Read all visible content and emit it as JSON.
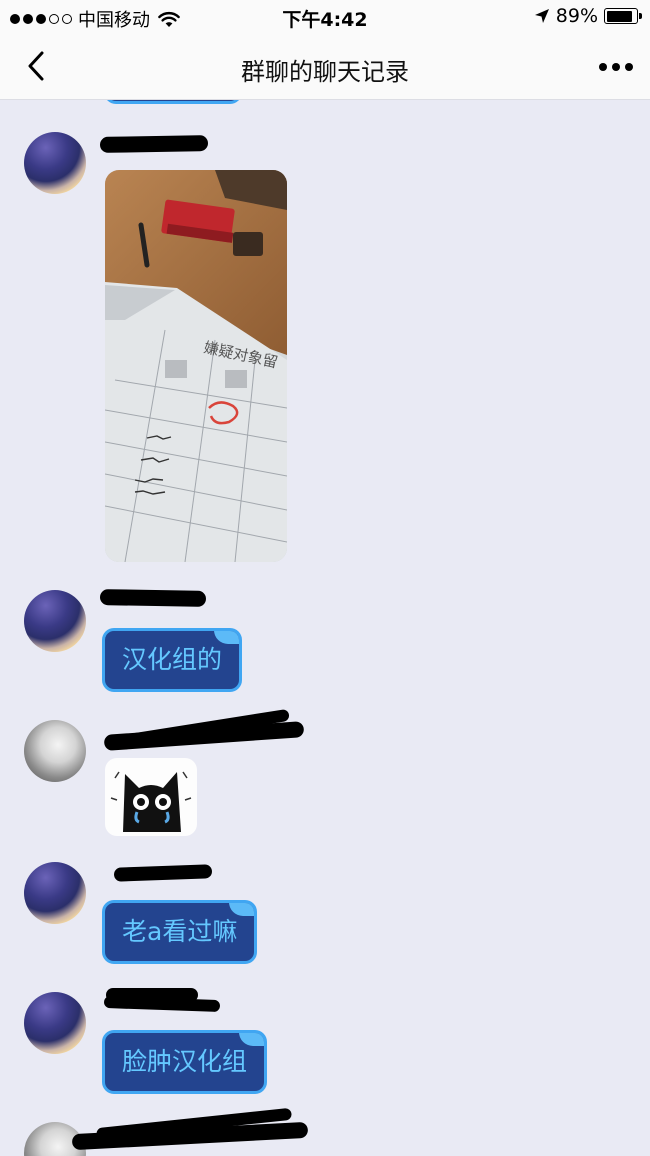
{
  "status_bar": {
    "carrier": "中国移动",
    "time": "下午4:42",
    "battery": "89%",
    "battery_level": 0.89
  },
  "nav": {
    "title": "群聊的聊天记录"
  },
  "messages": [
    {
      "nickname": "",
      "type": "image"
    },
    {
      "nickname": "",
      "type": "text",
      "text": "汉化组的"
    },
    {
      "nickname": "",
      "type": "sticker"
    },
    {
      "nickname": "",
      "type": "text",
      "text": "老a看过嘛"
    },
    {
      "nickname": "",
      "type": "text",
      "text": "脸肿汉化组"
    },
    {
      "nickname": "",
      "type": "partial"
    }
  ],
  "photo": {
    "form_title": "嫌疑对象留"
  },
  "colors": {
    "page_background": "#e9eaf4",
    "bubble_background": "#23448f",
    "bubble_border": "#40a6f2",
    "bubble_text": "#64c8ff"
  }
}
